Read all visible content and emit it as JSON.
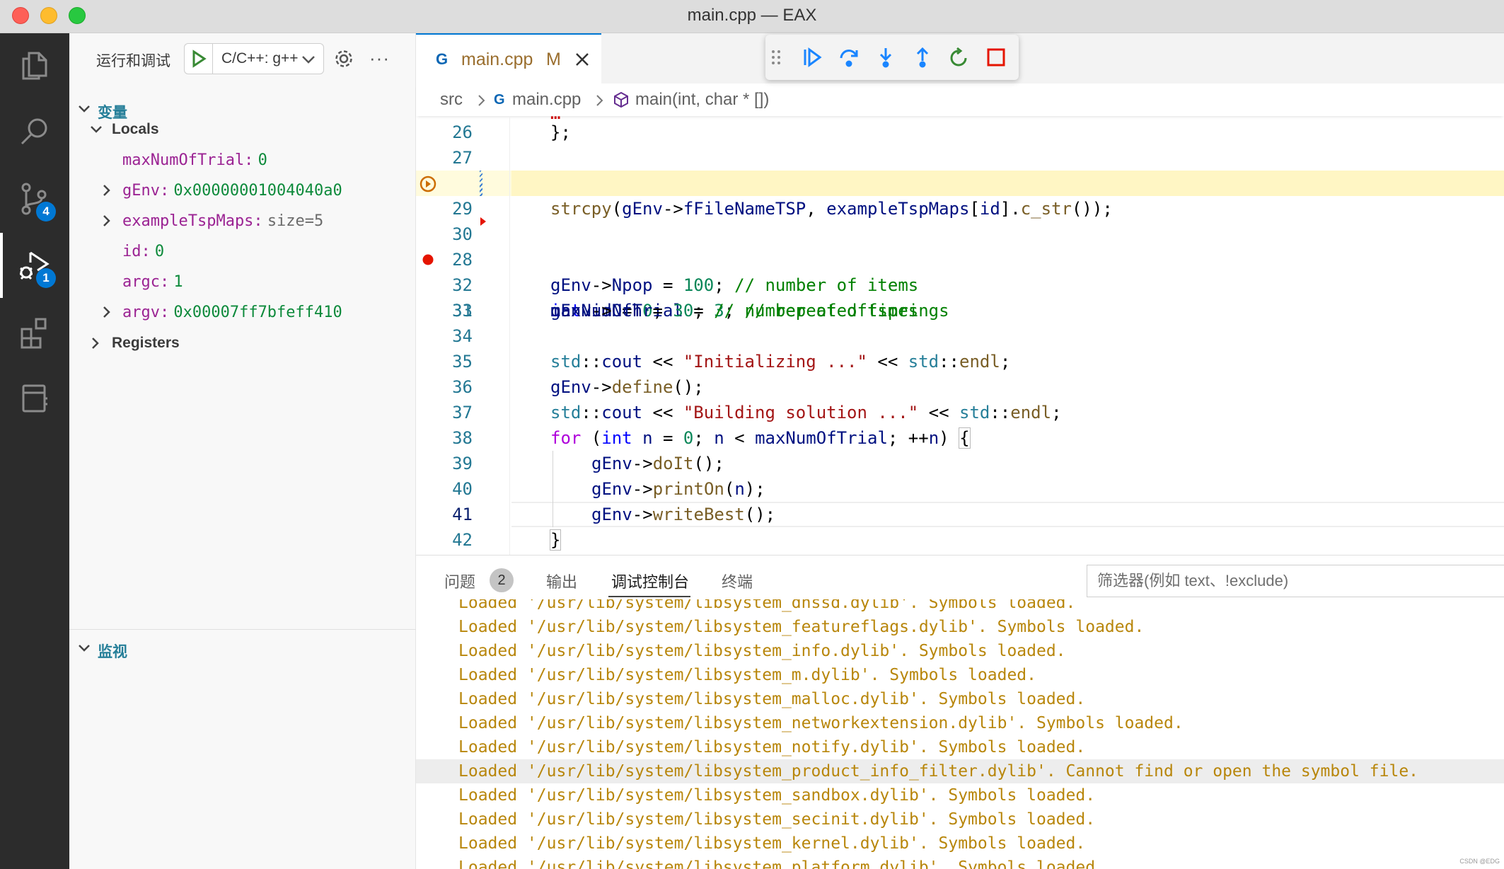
{
  "window": {
    "title": "main.cpp — EAX"
  },
  "activity_bar": {
    "items": [
      {
        "name": "explorer-icon"
      },
      {
        "name": "search-icon"
      },
      {
        "name": "source-control-icon",
        "badge": "4"
      },
      {
        "name": "run-debug-icon",
        "badge": "1",
        "active": true
      },
      {
        "name": "extensions-icon"
      },
      {
        "name": "notebook-icon"
      }
    ]
  },
  "sidebar": {
    "title": "运行和调试",
    "config": "C/C++: g++",
    "variables_label": "变量",
    "locals_label": "Locals",
    "locals": [
      {
        "name": "maxNumOfTrial:",
        "value": "0",
        "expandable": false
      },
      {
        "name": "gEnv:",
        "value": "0x00000001004040a0",
        "expandable": true
      },
      {
        "name": "exampleTspMaps:",
        "value": "size=5",
        "expandable": true,
        "muted": true
      },
      {
        "name": "id:",
        "value": "0",
        "expandable": false
      },
      {
        "name": "argc:",
        "value": "1",
        "expandable": false
      },
      {
        "name": "argv:",
        "value": "0x00007ff7bfeff410",
        "expandable": true
      }
    ],
    "registers_label": "Registers",
    "watch_label": "监视"
  },
  "editor": {
    "tab": {
      "label": "main.cpp",
      "modified": "M"
    },
    "breadcrumb": [
      "src",
      "main.cpp",
      "main(int, char * [])"
    ],
    "lines": [
      {
        "n": "26"
      },
      {
        "n": "27"
      },
      {
        "n": "28"
      },
      {
        "n": "29"
      },
      {
        "n": "30"
      },
      {
        "n": "31"
      },
      {
        "n": "32"
      },
      {
        "n": "33"
      },
      {
        "n": "34"
      },
      {
        "n": "35"
      },
      {
        "n": "36"
      },
      {
        "n": "37"
      },
      {
        "n": "38"
      },
      {
        "n": "39"
      },
      {
        "n": "40"
      },
      {
        "n": "41"
      },
      {
        "n": "42"
      }
    ]
  },
  "panel": {
    "tabs": [
      "问题",
      "输出",
      "调试控制台",
      "终端"
    ],
    "problems_count": "2",
    "filter_placeholder": "筛选器(例如 text、!exclude)",
    "console": [
      "Loaded '/usr/lib/system/libsystem_dnssd.dylib'. Symbols loaded.",
      "Loaded '/usr/lib/system/libsystem_featureflags.dylib'. Symbols loaded.",
      "Loaded '/usr/lib/system/libsystem_info.dylib'. Symbols loaded.",
      "Loaded '/usr/lib/system/libsystem_m.dylib'. Symbols loaded.",
      "Loaded '/usr/lib/system/libsystem_malloc.dylib'. Symbols loaded.",
      "Loaded '/usr/lib/system/libsystem_networkextension.dylib'. Symbols loaded.",
      "Loaded '/usr/lib/system/libsystem_notify.dylib'. Symbols loaded.",
      "Loaded '/usr/lib/system/libsystem_product_info_filter.dylib'. Cannot find or open the symbol file.",
      "Loaded '/usr/lib/system/libsystem_sandbox.dylib'. Symbols loaded.",
      "Loaded '/usr/lib/system/libsystem_secinit.dylib'. Symbols loaded.",
      "Loaded '/usr/lib/system/libsystem_kernel.dylib'. Symbols loaded.",
      "Loaded '/usr/lib/system/libsystem_platform.dylib'. Symbols loaded."
    ]
  },
  "watermark": "CSDN @EDG"
}
